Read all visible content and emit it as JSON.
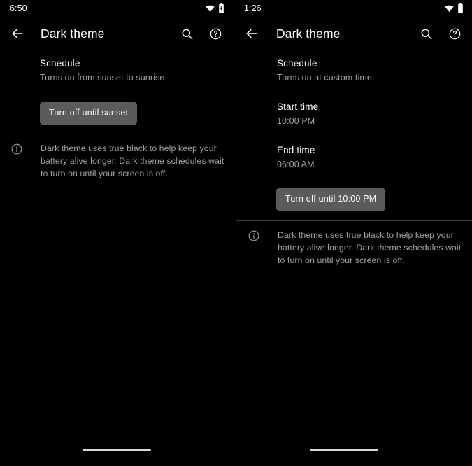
{
  "screens": [
    {
      "id": "left",
      "statusbar": {
        "time": "6:50",
        "icons": [
          "wifi-icon",
          "battery-charging-icon"
        ]
      },
      "appbar": {
        "back_icon": "back-arrow-icon",
        "title": "Dark theme",
        "actions": [
          "search-icon",
          "help-icon"
        ]
      },
      "schedule": {
        "title": "Schedule",
        "subtitle": "Turns on from sunset to sunrise"
      },
      "toggle_button": {
        "label": "Turn off until sunset",
        "background": "#5b5b5b",
        "text_color": "#ffffff"
      },
      "note": {
        "icon": "info-icon",
        "text": "Dark theme uses true black to help keep your battery alive longer. Dark theme schedules wait to turn on until your screen is off."
      },
      "gesture_pill": "home-gesture-pill"
    },
    {
      "id": "right",
      "statusbar": {
        "time": "1:26",
        "icons": [
          "wifi-icon",
          "battery-icon"
        ]
      },
      "appbar": {
        "back_icon": "back-arrow-icon",
        "title": "Dark theme",
        "actions": [
          "search-icon",
          "help-icon"
        ]
      },
      "schedule": {
        "title": "Schedule",
        "subtitle": "Turns on at custom time"
      },
      "start_time": {
        "title": "Start time",
        "value": "10:00 PM"
      },
      "end_time": {
        "title": "End time",
        "value": "06:00 AM"
      },
      "toggle_button": {
        "label": "Turn off until 10:00 PM",
        "background": "#5b5b5b",
        "text_color": "#ffffff"
      },
      "note": {
        "icon": "info-icon",
        "text": "Dark theme uses true black to help keep your battery alive longer. Dark theme schedules wait to turn on until your screen is off."
      },
      "gesture_pill": "home-gesture-pill"
    }
  ],
  "theme": {
    "background": "#000000",
    "primary_text": "#ffffff",
    "secondary_text": "#9aa0a6",
    "divider": "#3c3c3c",
    "button_background": "#5b5b5b"
  }
}
